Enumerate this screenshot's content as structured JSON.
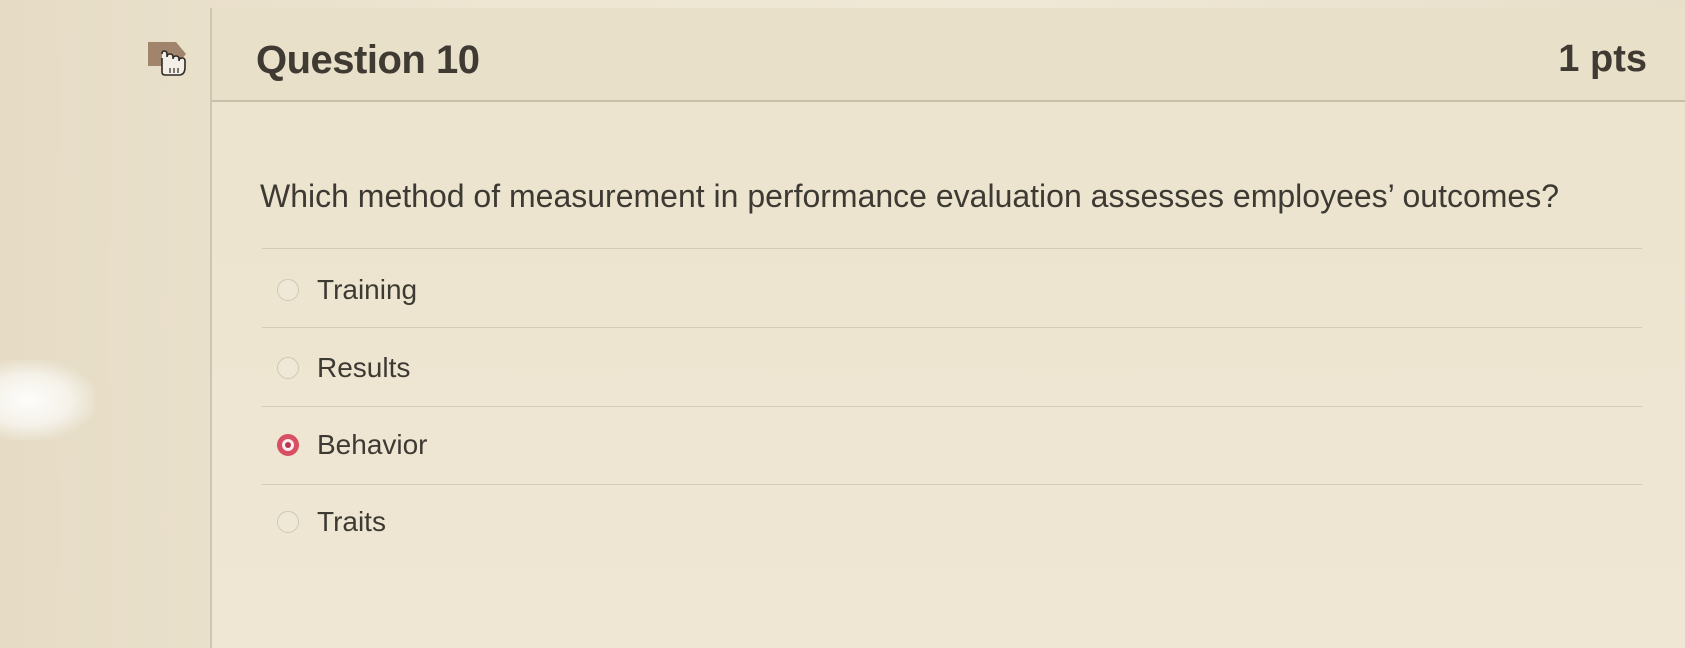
{
  "question": {
    "title": "Question 10",
    "points": "1 pts",
    "text": "Which method of measurement in performance evaluation assesses employees’ outcomes?",
    "flag_icon": "flag-bookmark-icon"
  },
  "answers": [
    {
      "label": "Training",
      "selected": false
    },
    {
      "label": "Results",
      "selected": false
    },
    {
      "label": "Behavior",
      "selected": true
    },
    {
      "label": "Traits",
      "selected": false
    }
  ],
  "colors": {
    "selected_radio": "#d84f63",
    "background": "#eee6d2",
    "text": "#3d3a33"
  }
}
